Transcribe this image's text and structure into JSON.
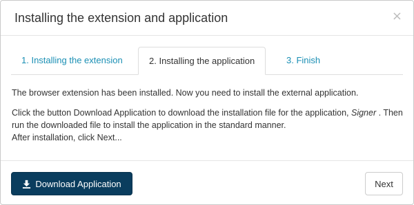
{
  "dialog": {
    "title": "Installing the extension and application",
    "close_glyph": "×"
  },
  "tabs": [
    {
      "label": "1. Installing the extension",
      "state": "inactive"
    },
    {
      "label": "2. Installing the application",
      "state": "active"
    },
    {
      "label": "3. Finish",
      "state": "inactive"
    }
  ],
  "content": {
    "paragraph1": "The browser extension has been installed. Now you need to install the external application.",
    "paragraph2_before": "Click the button Download Application to download the installation file for the application, ",
    "app_name": "Signer",
    "paragraph2_after": " . Then run the downloaded file to install the application in the standard manner.",
    "paragraph3": "After installation, click Next..."
  },
  "footer": {
    "download_label": "Download Application",
    "download_icon": "download-icon",
    "next_label": "Next"
  },
  "colors": {
    "primary_button": "#0a3d5e",
    "tab_link": "#1a8fb4",
    "text": "#333333"
  }
}
